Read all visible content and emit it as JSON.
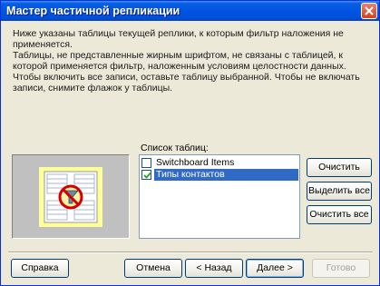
{
  "window": {
    "title": "Мастер частичной репликации"
  },
  "intro": "Ниже указаны таблицы текущей реплики, к которым фильтр наложения не применяется.",
  "description": "Таблицы, не представленные жирным шрифтом, не связаны с таблицей, к которой применяется фильтр, наложенным условиям целостности данных. Чтобы включить все записи, оставьте таблицу выбранной. Чтобы не включать записи, снимите флажок у таблицы.",
  "tables": {
    "label": "Список таблиц:",
    "items": [
      {
        "label": "Switchboard Items",
        "checked": false,
        "selected": false
      },
      {
        "label": "Типы контактов",
        "checked": true,
        "selected": true
      }
    ]
  },
  "buttons": {
    "clear": "Очистить",
    "select_all": "Выделить все",
    "clear_all": "Очистить все",
    "help": "Справка",
    "cancel": "Отмена",
    "back": "< Назад",
    "next": "Далее >",
    "finish": "Готово"
  },
  "colors": {
    "titlebar": "#0054e3",
    "selection": "#316ac5",
    "dialog_bg": "#ece9d8"
  },
  "icons": {
    "preview": "filtered-table-icon",
    "close": "close-icon"
  }
}
